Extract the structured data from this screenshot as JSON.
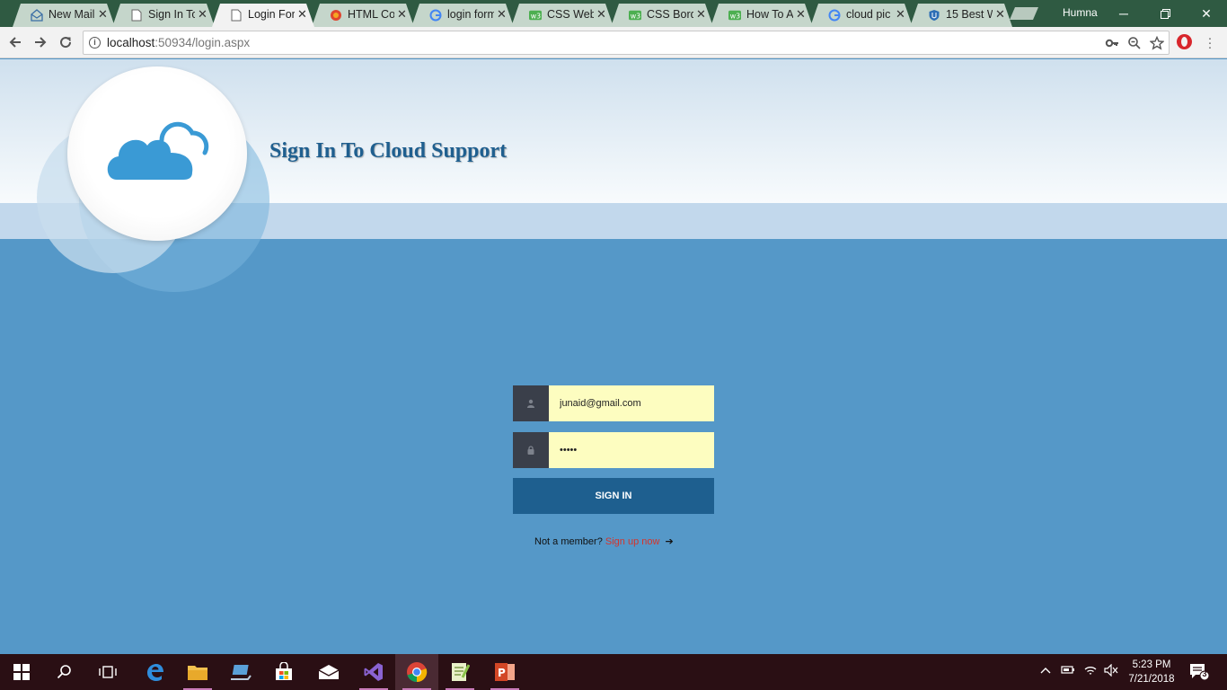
{
  "browser": {
    "tabs": [
      {
        "title": "New Mail",
        "icon": "mail-icon"
      },
      {
        "title": "Sign In To",
        "icon": "page-icon"
      },
      {
        "title": "Login For",
        "icon": "page-icon"
      },
      {
        "title": "HTML Col",
        "icon": "colorful-circle-icon"
      },
      {
        "title": "login form",
        "icon": "google-icon"
      },
      {
        "title": "CSS Web",
        "icon": "w3schools-icon"
      },
      {
        "title": "CSS Bord",
        "icon": "w3schools-icon"
      },
      {
        "title": "How To A",
        "icon": "w3schools-icon"
      },
      {
        "title": "cloud pic",
        "icon": "google-icon"
      },
      {
        "title": "15 Best W",
        "icon": "shield-icon"
      }
    ],
    "profile_name": "Humna",
    "address_host": "localhost",
    "address_rest": ":50934/login.aspx"
  },
  "page": {
    "title": "Sign In To Cloud Support",
    "email_value": "junaid@gmail.com",
    "password_value": "12345",
    "signin_label": "SIGN IN",
    "not_member_text": "Not a member?",
    "signup_link": "Sign up now"
  },
  "taskbar": {
    "time": "5:23 PM",
    "date": "7/21/2018",
    "notification_count": "3"
  },
  "colors": {
    "page_background": "#5598c8",
    "signin_button": "#1e5f8f",
    "input_background": "#fdfdc0",
    "signup_link": "#d5342b"
  }
}
